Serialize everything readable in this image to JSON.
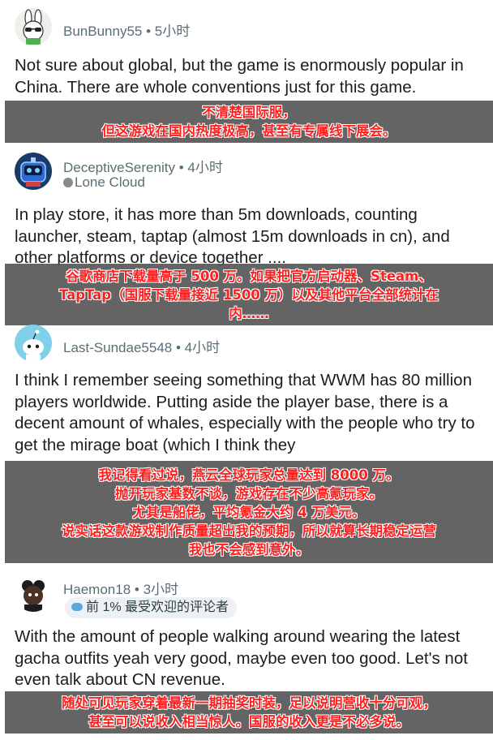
{
  "comments": [
    {
      "username": "BunBunny55",
      "separator": "•",
      "time": "5小时",
      "avatar_icon": "bunny-avatar-icon",
      "body": "Not sure about global, but the game is enormously popular in China. There are whole conventions just for this game.",
      "translation": [
        "不清楚国际服，",
        "但这游戏在国内热度极高，甚至有专属线下展会。"
      ]
    },
    {
      "username": "DeceptiveSerenity",
      "separator": "•",
      "time": "4小时",
      "flair": "Lone Cloud",
      "flair_icon": "cloud-flair-icon",
      "avatar_icon": "robot-avatar-icon",
      "body": "In play store, it has more than 5m downloads, counting launcher, steam, taptap (almost 15m downloads in cn), and other platforms or device together ....",
      "translation": [
        "谷歌商店下载量高于 500 万。如果把官方启动器、Steam、",
        "TapTap（国服下载量接近 1500 万）以及其他平台全部统计在",
        "内……"
      ]
    },
    {
      "username": "Last-Sundae5548",
      "separator": "•",
      "time": "4小时",
      "avatar_icon": "snoo-avatar-icon",
      "body": "I think I remember seeing something that WWM has 80 million players worldwide. Putting aside the player base, there is a decent amount of whales, especially with the people who try to get the mirage boat (which I think they",
      "translation": [
        "我记得看过说，燕云全球玩家总量达到 8000 万。",
        "抛开玩家基数不谈，游戏存在不少高氪玩家。",
        "尤其是船佬，平均氪金大约 4 万美元。",
        "说实话这款游戏制作质量超出我的预期，所以就算长期稳定运营",
        "我也不会感到意外。"
      ]
    },
    {
      "username": "Haemon18",
      "separator": "•",
      "time": "3小时",
      "badge": "前 1% 最受欢迎的评论者",
      "badge_icon": "top-commenter-icon",
      "avatar_icon": "dark-avatar-icon",
      "body": "With the amount of people walking around wearing the latest gacha outfits yeah very good, maybe even too good. Let's not even talk about CN revenue.",
      "translation": [
        "随处可见玩家穿着最新一期抽奖时装，足以说明营收十分可观，",
        "甚至可以说收入相当惊人。国服的收入更是不必多说。"
      ]
    }
  ],
  "colors": {
    "overlay_bg": "#585858",
    "overlay_text": "#ff1f1f",
    "meta_text": "#576f76",
    "body_text": "#1c1c1c"
  }
}
